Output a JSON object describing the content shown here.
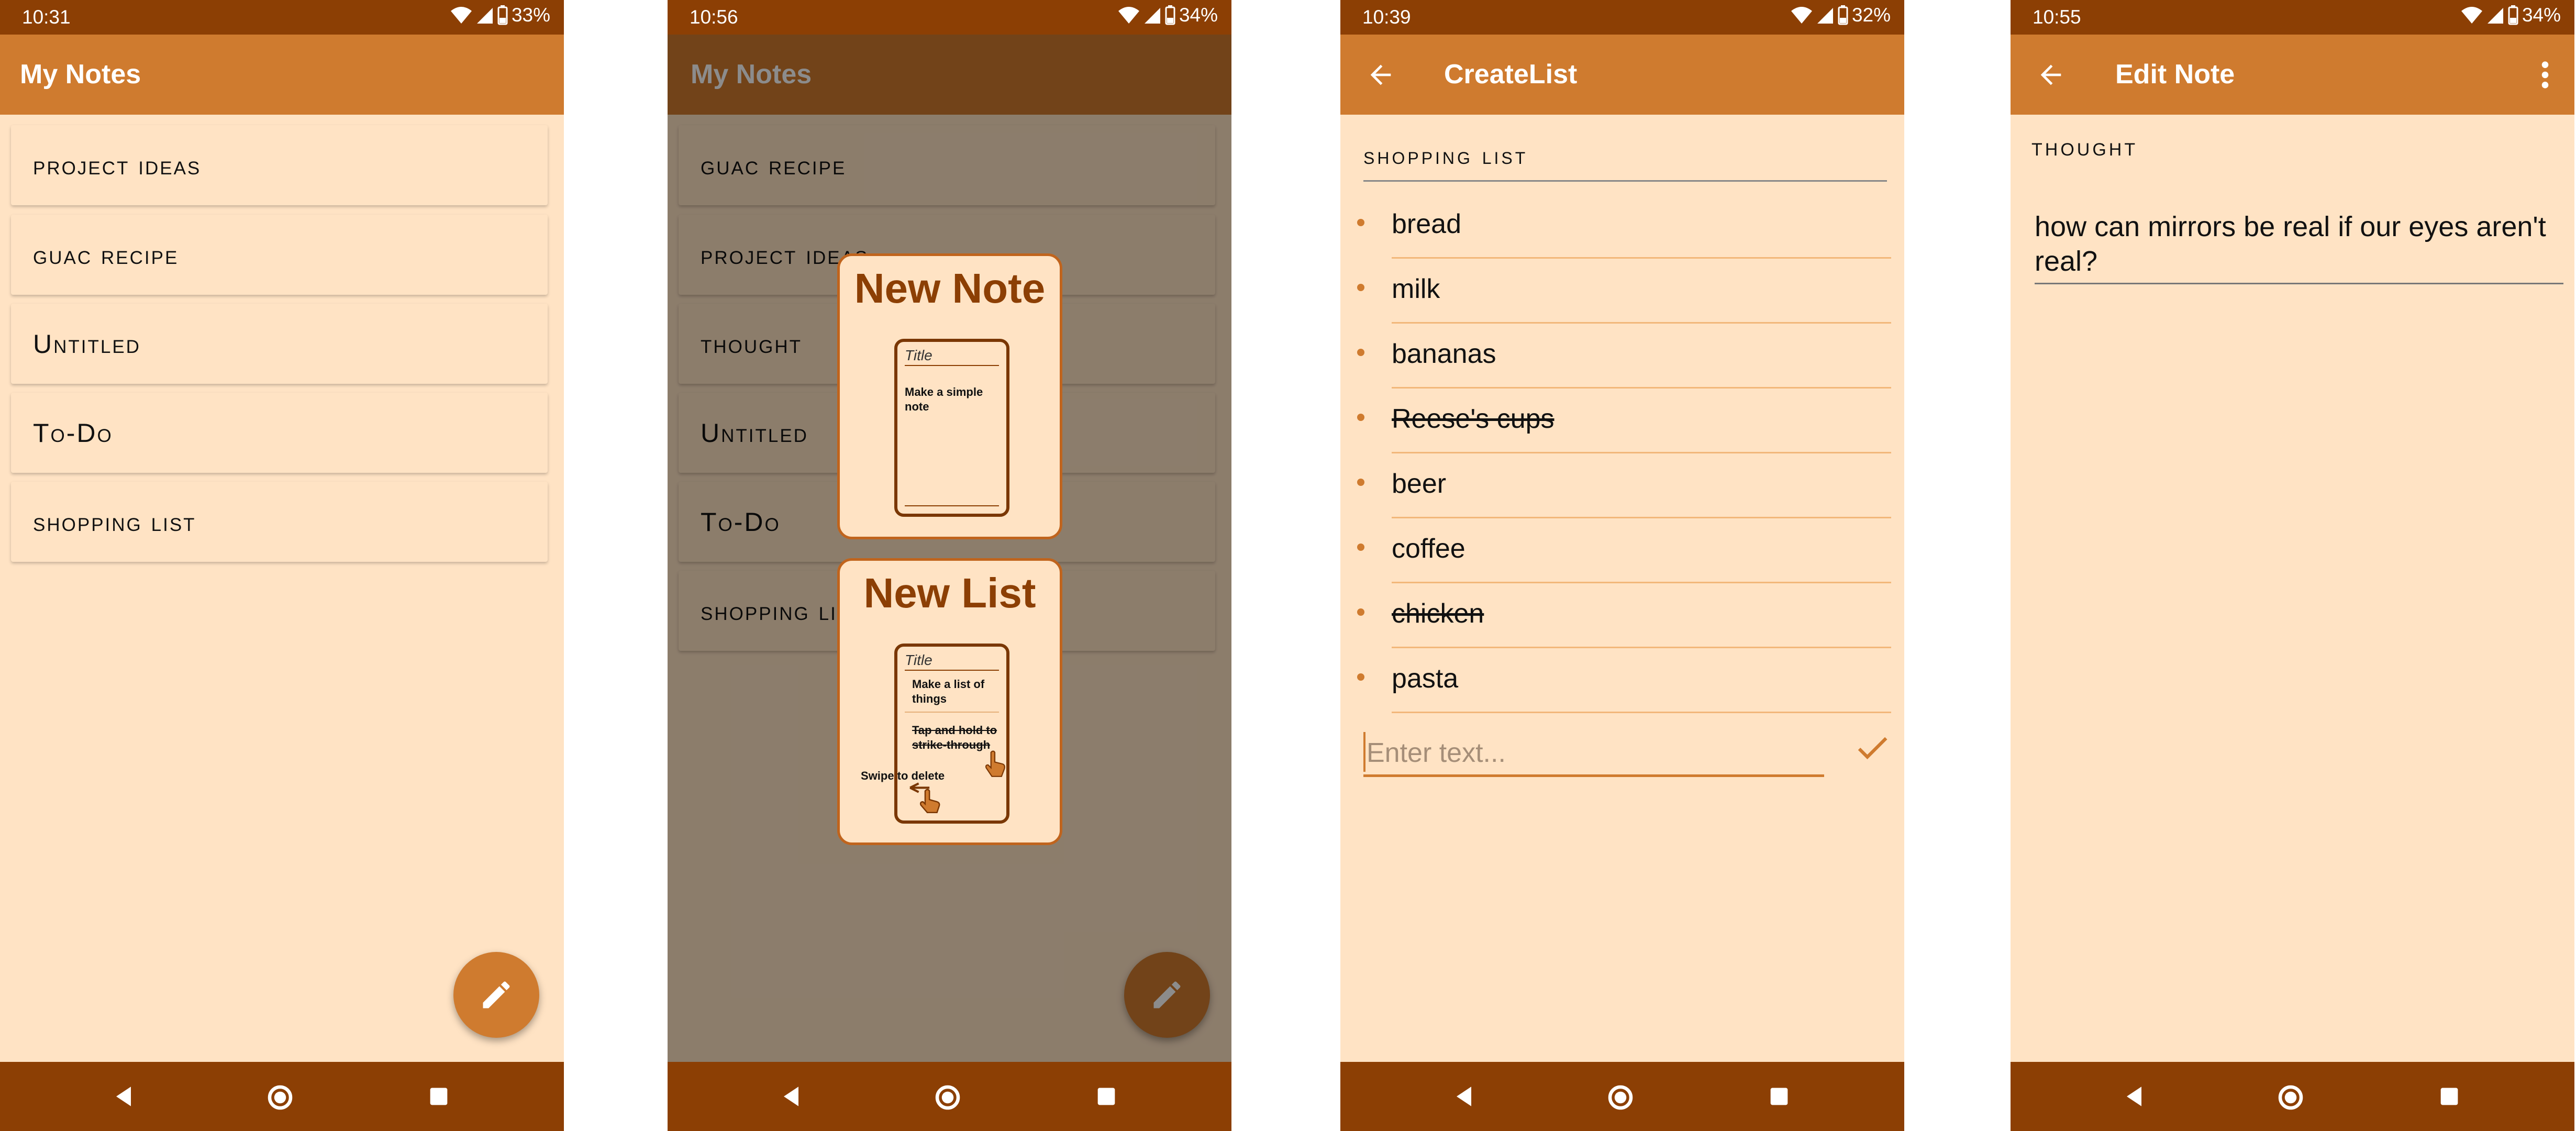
{
  "status": {
    "screen1": {
      "time": "10:31",
      "battery": "33%"
    },
    "screen2": {
      "time": "10:56",
      "battery": "34%"
    },
    "screen3": {
      "time": "10:39",
      "battery": "32%"
    },
    "screen4": {
      "time": "10:55",
      "battery": "34%"
    }
  },
  "colors": {
    "status_bar": "#8c3f04",
    "app_bar": "#cf7b2f",
    "background": "#ffe3c4",
    "accent": "#cf7b2f"
  },
  "screen1": {
    "title": "My Notes",
    "notes": [
      "project ideas",
      "guac recipe",
      "Untitled",
      "To-Do",
      "shopping list"
    ]
  },
  "screen2": {
    "title": "My Notes",
    "notes": [
      "guac recipe",
      "project ideas",
      "thought",
      "Untitled",
      "To-Do",
      "shopping list"
    ],
    "new_note": {
      "heading": "New Note",
      "mock_title": "Title",
      "mock_text": "Make a simple note"
    },
    "new_list": {
      "heading": "New List",
      "mock_title": "Title",
      "item1": "Make a list of things",
      "item2": "Tap and hold to strike-through",
      "item3": "Swipe to delete"
    }
  },
  "screen3": {
    "title": "CreateList",
    "list_title": "shopping list",
    "items": [
      {
        "text": "bread",
        "struck": false
      },
      {
        "text": "milk",
        "struck": false
      },
      {
        "text": "bananas",
        "struck": false
      },
      {
        "text": "Reese's cups",
        "struck": true
      },
      {
        "text": "beer",
        "struck": false
      },
      {
        "text": "coffee",
        "struck": false
      },
      {
        "text": "chicken",
        "struck": true
      },
      {
        "text": "pasta",
        "struck": false
      }
    ],
    "entry_placeholder": "Enter text..."
  },
  "screen4": {
    "title": "Edit Note",
    "note_title": "thought",
    "note_body": "how can mirrors be real if our eyes aren't real?"
  },
  "icons": {
    "fab": "pencil-icon",
    "back": "arrow-back-icon",
    "more": "more-vert-icon",
    "check": "check-icon",
    "nav": [
      "nav-back-icon",
      "nav-home-icon",
      "nav-recent-icon"
    ],
    "status": [
      "wifi-icon",
      "signal-icon",
      "battery-icon"
    ]
  }
}
